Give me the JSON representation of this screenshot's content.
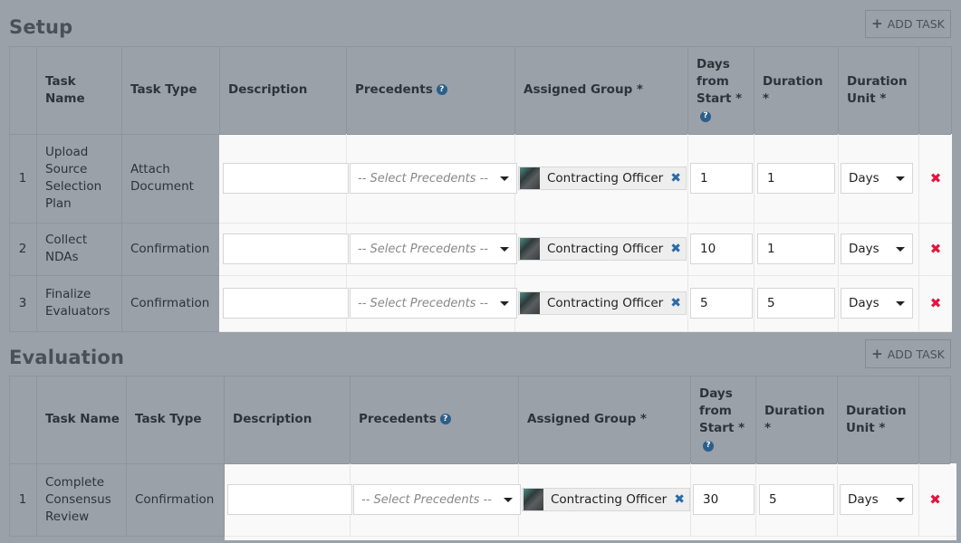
{
  "sections": [
    {
      "title": "Setup",
      "add_task_label": "ADD TASK",
      "headers": {
        "num": "",
        "task_name": "Task Name",
        "task_type": "Task Type",
        "description": "Description",
        "precedents": "Precedents",
        "assigned_group": "Assigned Group *",
        "days_from_start": "Days from Start *",
        "duration": "Duration *",
        "duration_unit": "Duration Unit *"
      },
      "rows": [
        {
          "num": "1",
          "task_name": "Upload Source Selection Plan",
          "task_type": "Attach Document",
          "description": "",
          "precedents_placeholder": "-- Select Precedents --",
          "assigned_group": "Contracting Officer",
          "days_from_start": "1",
          "duration": "1",
          "duration_unit": "Days"
        },
        {
          "num": "2",
          "task_name": "Collect NDAs",
          "task_type": "Confirmation",
          "description": "",
          "precedents_placeholder": "-- Select Precedents --",
          "assigned_group": "Contracting Officer",
          "days_from_start": "10",
          "duration": "1",
          "duration_unit": "Days"
        },
        {
          "num": "3",
          "task_name": "Finalize Evaluators",
          "task_type": "Confirmation",
          "description": "",
          "precedents_placeholder": "-- Select Precedents --",
          "assigned_group": "Contracting Officer",
          "days_from_start": "5",
          "duration": "5",
          "duration_unit": "Days"
        }
      ]
    },
    {
      "title": "Evaluation",
      "add_task_label": "ADD TASK",
      "headers": {
        "num": "",
        "task_name": "Task Name",
        "task_type": "Task Type",
        "description": "Description",
        "precedents": "Precedents",
        "assigned_group": "Assigned Group *",
        "days_from_start": "Days from Start *",
        "duration": "Duration *",
        "duration_unit": "Duration Unit *"
      },
      "rows": [
        {
          "num": "1",
          "task_name": "Complete Consensus Review",
          "task_type": "Confirmation",
          "description": "",
          "precedents_placeholder": "-- Select Precedents --",
          "assigned_group": "Contracting Officer",
          "days_from_start": "30",
          "duration": "5",
          "duration_unit": "Days"
        }
      ]
    }
  ],
  "icons": {
    "help": "?",
    "plus": "+",
    "remove_tag": "✖",
    "delete_row": "✖"
  },
  "colors": {
    "overlay": "#9aa1a9",
    "help_icon": "#2b5f8a",
    "tag_remove": "#2a6aa8",
    "delete_row": "#e0163f"
  }
}
